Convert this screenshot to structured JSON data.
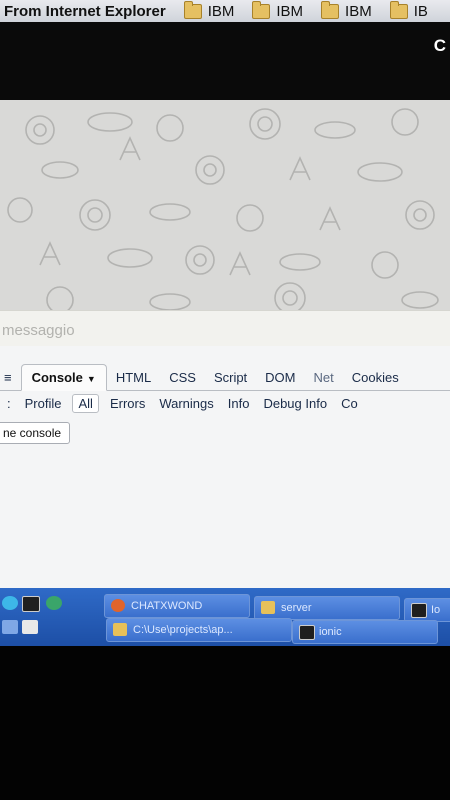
{
  "bookmarks": [
    {
      "label": "From Internet Explorer"
    },
    {
      "label": "IBM"
    },
    {
      "label": "IBM"
    },
    {
      "label": "IBM"
    },
    {
      "label": "IB"
    }
  ],
  "top_right_label": "C",
  "message": {
    "placeholder": "messaggio",
    "value": ""
  },
  "firebug": {
    "tabs": [
      {
        "label": "Console",
        "active": true
      },
      {
        "label": "HTML"
      },
      {
        "label": "CSS"
      },
      {
        "label": "Script"
      },
      {
        "label": "DOM"
      },
      {
        "label": "Net"
      },
      {
        "label": "Cookies"
      }
    ],
    "filters": [
      "Profile",
      "All",
      "Errors",
      "Warnings",
      "Info",
      "Debug Info",
      "Co"
    ],
    "console_button": "ne console"
  },
  "taskbar": {
    "row1": [
      {
        "label": "CHATXWOND",
        "icon_color": "#e0642b"
      },
      {
        "label": "server",
        "icon_color": "#e7c15a"
      },
      {
        "label": "Io",
        "icon_color": "#1f1f1f"
      }
    ],
    "row2": [
      {
        "label": "C:\\Use\\projects\\ap...",
        "icon_color": "#e7c15a"
      },
      {
        "label": "ionic",
        "icon_color": "#1f1f1f"
      }
    ]
  },
  "colors": {
    "taskbar": "#2f6ac7",
    "firebug_bg": "#f4f5f6",
    "wallpaper": "#d9d9d7"
  }
}
